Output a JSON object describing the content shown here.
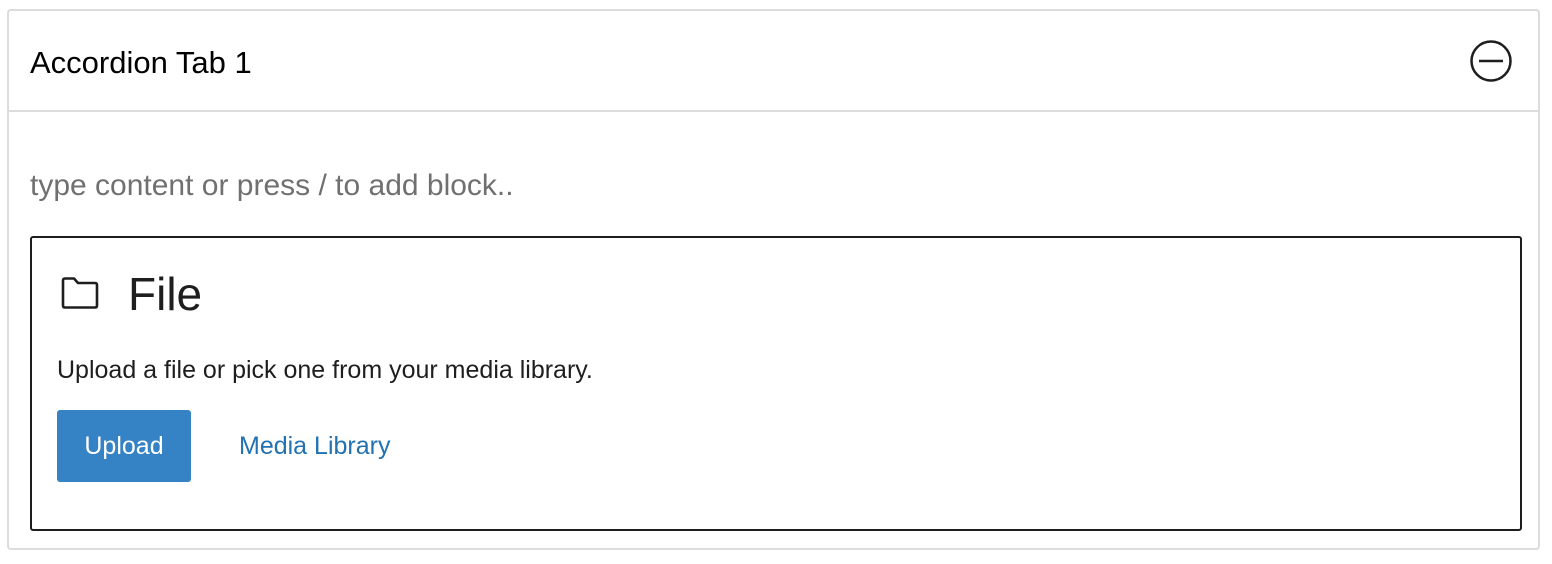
{
  "accordion": {
    "tab_title": "Accordion Tab 1",
    "toggle_icon": "minus-circle-icon",
    "content_placeholder": "type content or press / to add block.."
  },
  "file_block": {
    "icon": "folder-icon",
    "title": "File",
    "description": "Upload a file or pick one from your media library.",
    "upload_label": "Upload",
    "media_library_label": "Media Library"
  },
  "colors": {
    "accent": "#3582c4",
    "link": "#2271b1",
    "border": "#dcdcde",
    "placeholder_text": "#707070"
  }
}
